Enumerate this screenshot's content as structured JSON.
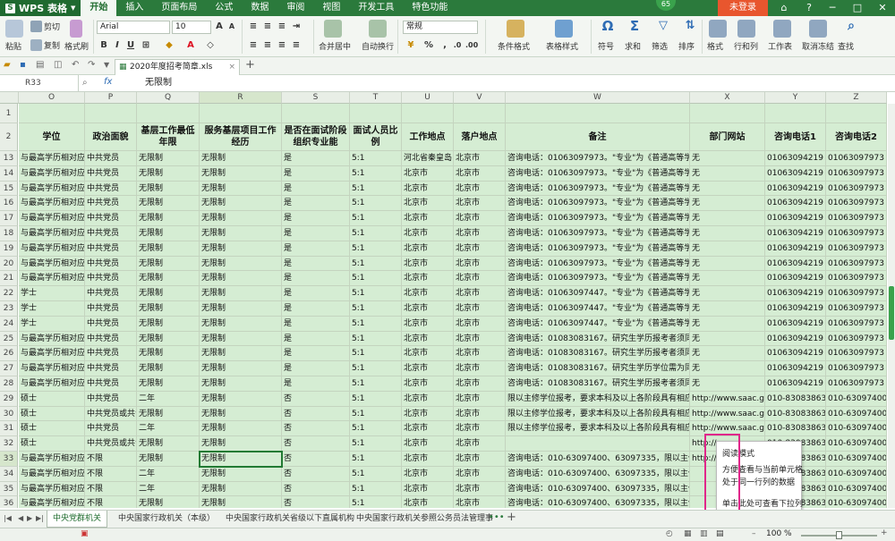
{
  "app": {
    "name": "WPS 表格",
    "badge": "65",
    "login": "未登录"
  },
  "menu": [
    "开始",
    "插入",
    "页面布局",
    "公式",
    "数据",
    "审阅",
    "视图",
    "开发工具",
    "特色功能"
  ],
  "ribbon": {
    "paste": "粘贴",
    "cut": "剪切",
    "copy": "复制",
    "format_painter": "格式刷",
    "font_name": "Arial",
    "font_size": "10",
    "merge_center": "合并居中",
    "wrap_text": "自动换行",
    "number_format": "常规",
    "percent": "%",
    "cond_format": "条件格式",
    "table_style": "表格样式",
    "symbol": "符号",
    "sum": "求和",
    "filter": "筛选",
    "sort": "排序",
    "format": "格式",
    "rowcol": "行和列",
    "worksheet": "工作表",
    "freeze": "取消冻结",
    "find": "查找"
  },
  "document": {
    "tab_title": "2020年度招考简章.xls"
  },
  "formula_bar": {
    "cell_ref": "R33",
    "value": "无限制"
  },
  "grid": {
    "columns": [
      {
        "letter": "O",
        "header": "学位"
      },
      {
        "letter": "P",
        "header": "政治面貌"
      },
      {
        "letter": "Q",
        "header": "基层工作最低年限"
      },
      {
        "letter": "R",
        "header": "服务基层项目工作经历"
      },
      {
        "letter": "S",
        "header": "是否在面试阶段组织专业能"
      },
      {
        "letter": "T",
        "header": "面试人员比例"
      },
      {
        "letter": "U",
        "header": "工作地点"
      },
      {
        "letter": "V",
        "header": "落户地点"
      },
      {
        "letter": "W",
        "header": "备注"
      },
      {
        "letter": "X",
        "header": "部门网站"
      },
      {
        "letter": "Y",
        "header": "咨询电话1"
      },
      {
        "letter": "Z",
        "header": "咨询电话2"
      }
    ],
    "rows": [
      {
        "n": "13",
        "c": [
          "与最高学历相对应",
          "中共党员",
          "无限制",
          "无限制",
          "是",
          "5:1",
          "河北省秦皇岛",
          "北京市",
          "咨询电话：01063097973。\"专业\"为《普通高等学校",
          "无",
          "01063094219",
          "01063097973"
        ]
      },
      {
        "n": "14",
        "c": [
          "与最高学历相对应",
          "中共党员",
          "无限制",
          "无限制",
          "是",
          "5:1",
          "北京市",
          "北京市",
          "咨询电话：01063097973。\"专业\"为《普通高等学校",
          "无",
          "01063094219",
          "01063097973"
        ]
      },
      {
        "n": "15",
        "c": [
          "与最高学历相对应",
          "中共党员",
          "无限制",
          "无限制",
          "是",
          "5:1",
          "北京市",
          "北京市",
          "咨询电话：01063097973。\"专业\"为《普通高等学校",
          "无",
          "01063094219",
          "01063097973"
        ]
      },
      {
        "n": "16",
        "c": [
          "与最高学历相对应",
          "中共党员",
          "无限制",
          "无限制",
          "是",
          "5:1",
          "北京市",
          "北京市",
          "咨询电话：01063097973。\"专业\"为《普通高等学校",
          "无",
          "01063094219",
          "01063097973"
        ]
      },
      {
        "n": "17",
        "c": [
          "与最高学历相对应",
          "中共党员",
          "无限制",
          "无限制",
          "是",
          "5:1",
          "北京市",
          "北京市",
          "咨询电话：01063097973。\"专业\"为《普通高等学校",
          "无",
          "01063094219",
          "01063097973"
        ]
      },
      {
        "n": "18",
        "c": [
          "与最高学历相对应",
          "中共党员",
          "无限制",
          "无限制",
          "是",
          "5:1",
          "北京市",
          "北京市",
          "咨询电话：01063097973。\"专业\"为《普通高等学校",
          "无",
          "01063094219",
          "01063097973"
        ]
      },
      {
        "n": "19",
        "c": [
          "与最高学历相对应",
          "中共党员",
          "无限制",
          "无限制",
          "是",
          "5:1",
          "北京市",
          "北京市",
          "咨询电话：01063097973。\"专业\"为《普通高等学校",
          "无",
          "01063094219",
          "01063097973"
        ]
      },
      {
        "n": "20",
        "c": [
          "与最高学历相对应",
          "中共党员",
          "无限制",
          "无限制",
          "是",
          "5:1",
          "北京市",
          "北京市",
          "咨询电话：01063097973。\"专业\"为《普通高等学校",
          "无",
          "01063094219",
          "01063097973"
        ]
      },
      {
        "n": "21",
        "c": [
          "与最高学历相对应",
          "中共党员",
          "无限制",
          "无限制",
          "是",
          "5:1",
          "北京市",
          "北京市",
          "咨询电话：01063097973。\"专业\"为《普通高等学校",
          "无",
          "01063094219",
          "01063097973"
        ]
      },
      {
        "n": "22",
        "c": [
          "学士",
          "中共党员",
          "无限制",
          "无限制",
          "是",
          "5:1",
          "北京市",
          "北京市",
          "咨询电话：01063097447。\"专业\"为《普通高等学校",
          "无",
          "01063094219",
          "01063097973"
        ]
      },
      {
        "n": "23",
        "c": [
          "学士",
          "中共党员",
          "无限制",
          "无限制",
          "是",
          "5:1",
          "北京市",
          "北京市",
          "咨询电话：01063097447。\"专业\"为《普通高等学校",
          "无",
          "01063094219",
          "01063097973"
        ]
      },
      {
        "n": "24",
        "c": [
          "学士",
          "中共党员",
          "无限制",
          "无限制",
          "是",
          "5:1",
          "北京市",
          "北京市",
          "咨询电话：01063097447。\"专业\"为《普通高等学校",
          "无",
          "01063094219",
          "01063097973"
        ]
      },
      {
        "n": "25",
        "c": [
          "与最高学历相对应",
          "中共党员",
          "无限制",
          "无限制",
          "是",
          "5:1",
          "北京市",
          "北京市",
          "咨询电话：01083083167。研究生学历报考者须同时",
          "无",
          "01063094219",
          "01063097973"
        ]
      },
      {
        "n": "26",
        "c": [
          "与最高学历相对应",
          "中共党员",
          "无限制",
          "无限制",
          "是",
          "5:1",
          "北京市",
          "北京市",
          "咨询电话：01083083167。研究生学历报考者须同时",
          "无",
          "01063094219",
          "01063097973"
        ]
      },
      {
        "n": "27",
        "c": [
          "与最高学历相对应",
          "中共党员",
          "无限制",
          "无限制",
          "是",
          "5:1",
          "北京市",
          "北京市",
          "咨询电话：01083083167。研究生学历学位需为同一专",
          "无",
          "01063094219",
          "01063097973"
        ]
      },
      {
        "n": "28",
        "c": [
          "与最高学历相对应",
          "中共党员",
          "无限制",
          "无限制",
          "是",
          "5:1",
          "北京市",
          "北京市",
          "咨询电话：01083083167。研究生学历报考者须同时",
          "无",
          "01063094219",
          "01063097973"
        ]
      },
      {
        "n": "29",
        "c": [
          "硕士",
          "中共党员",
          "二年",
          "无限制",
          "否",
          "5:1",
          "北京市",
          "北京市",
          "限以主修学位报考，要求本科及以上各阶段具有相应",
          "http://www.saac.gov.",
          "010-83083863",
          "010-63097400"
        ]
      },
      {
        "n": "30",
        "c": [
          "硕士",
          "中共党员或共青",
          "无限制",
          "无限制",
          "否",
          "5:1",
          "北京市",
          "北京市",
          "限以主修学位报考，要求本科及以上各阶段具有相应",
          "http://www.saac.gov.",
          "010-83083863",
          "010-63097400"
        ]
      },
      {
        "n": "31",
        "c": [
          "硕士",
          "中共党员",
          "二年",
          "无限制",
          "否",
          "5:1",
          "北京市",
          "北京市",
          "限以主修学位报考，要求本科及以上各阶段具有相应",
          "http://www.saac.gov.",
          "010-83083863",
          "010-63097400"
        ]
      },
      {
        "n": "32",
        "c": [
          "硕士",
          "中共党员或共青",
          "无限制",
          "无限制",
          "否",
          "5:1",
          "北京市",
          "北京市",
          "",
          "http://",
          "010-83083863",
          "010-63097400"
        ]
      },
      {
        "n": "33",
        "c": [
          "与最高学历相对应",
          "不限",
          "无限制",
          "无限制",
          "否",
          "5:1",
          "北京市",
          "北京市",
          "咨询电话：010-63097400、63097335，限以主修学",
          "http://",
          "010-83083863",
          "010-63097400"
        ]
      },
      {
        "n": "34",
        "c": [
          "与最高学历相对应",
          "不限",
          "二年",
          "无限制",
          "否",
          "5:1",
          "北京市",
          "北京市",
          "咨询电话：010-63097400、63097335，限以主修学",
          "",
          "010-83083863",
          "010-63097400"
        ]
      },
      {
        "n": "35",
        "c": [
          "与最高学历相对应",
          "不限",
          "二年",
          "无限制",
          "否",
          "5:1",
          "北京市",
          "北京市",
          "咨询电话：010-63097400、63097335，限以主修学",
          "",
          "010-83083863",
          "010-63097400"
        ]
      },
      {
        "n": "36",
        "c": [
          "与最高学历相对应",
          "不限",
          "无限制",
          "无限制",
          "否",
          "5:1",
          "北京市",
          "北京市",
          "咨询电话：010-63097400、63097335，限以主修学",
          "",
          "010-83083863",
          "010-63097400"
        ]
      }
    ]
  },
  "context_menu": {
    "items": [
      "阅读模式",
      "方便查看与当前单元格",
      "处于同一行列的数据",
      "单击此处可查看下拉列",
      "表。"
    ]
  },
  "sheet_tabs": [
    "中央党群机关",
    "中央国家行政机关（本级）",
    "中央国家行政机关省级以下直属机构",
    "中央国家行政机关参照公务员法管理事"
  ],
  "status": {
    "zoom": "100 %"
  },
  "colors": {
    "brand": "#2b7a3c",
    "cell_fill": "#d5edd3",
    "highlight": "#e0278a",
    "login": "#e8562e"
  }
}
